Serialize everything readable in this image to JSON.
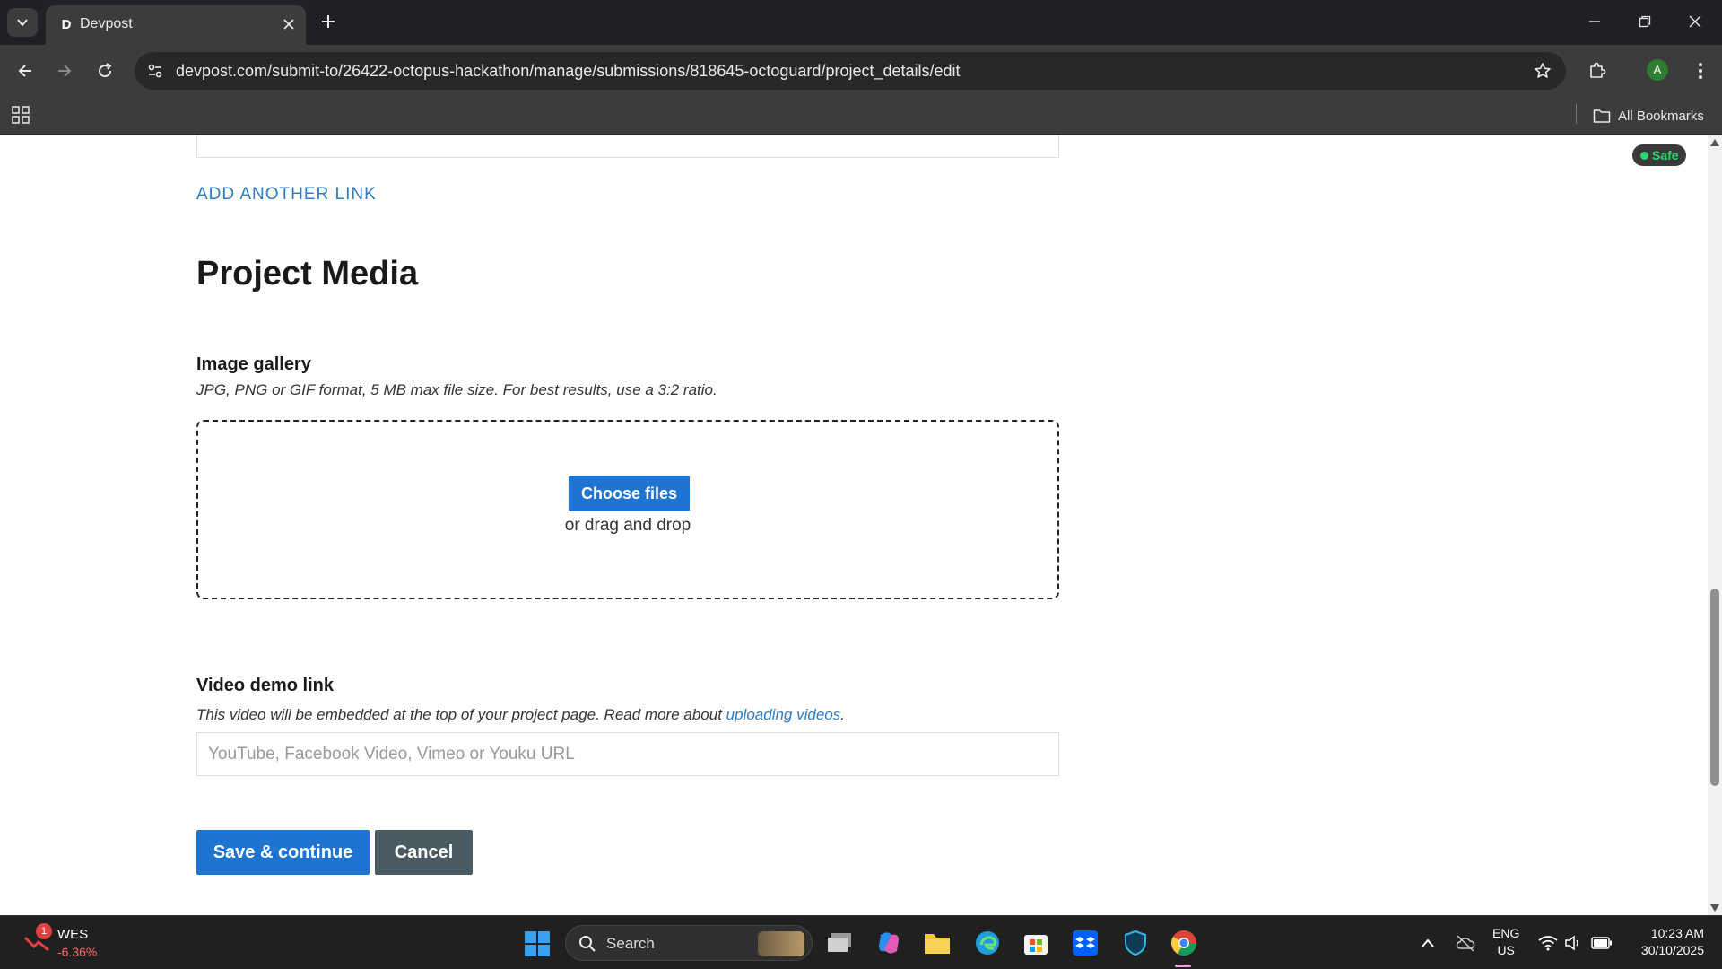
{
  "browser": {
    "tab_title": "Devpost",
    "tab_favicon_letter": "D",
    "url_host": "devpost.com",
    "url_path": "/submit-to/26422-octopus-hackathon/manage/submissions/818645-octoguard/project_details/edit",
    "bookmarks_label": "All Bookmarks",
    "profile_initial": "A"
  },
  "page": {
    "add_link_label": "ADD ANOTHER LINK",
    "section_title": "Project Media",
    "gallery": {
      "label": "Image gallery",
      "hint": "JPG, PNG or GIF format, 5 MB max file size. For best results, use a 3:2 ratio.",
      "choose_label": "Choose files",
      "drag_label": "or drag and drop"
    },
    "video": {
      "label": "Video demo link",
      "hint_prefix": "This video will be embedded at the top of your project page. Read more about ",
      "hint_link": "uploading videos",
      "hint_suffix": ".",
      "placeholder": "YouTube, Facebook Video, Vimeo or Youku URL",
      "value": ""
    },
    "save_label": "Save & continue",
    "cancel_label": "Cancel",
    "safe_badge": "Safe"
  },
  "taskbar": {
    "weather_name": "WES",
    "weather_change": "-6.36%",
    "weather_badge": "1",
    "search_label": "Search",
    "lang_top": "ENG",
    "lang_bottom": "US",
    "time": "10:23 AM",
    "date": "30/10/2025"
  },
  "colors": {
    "accent": "#1f74d2",
    "link": "#2d7bc4",
    "cancel": "#4a5a63",
    "safe": "#2ed573"
  }
}
